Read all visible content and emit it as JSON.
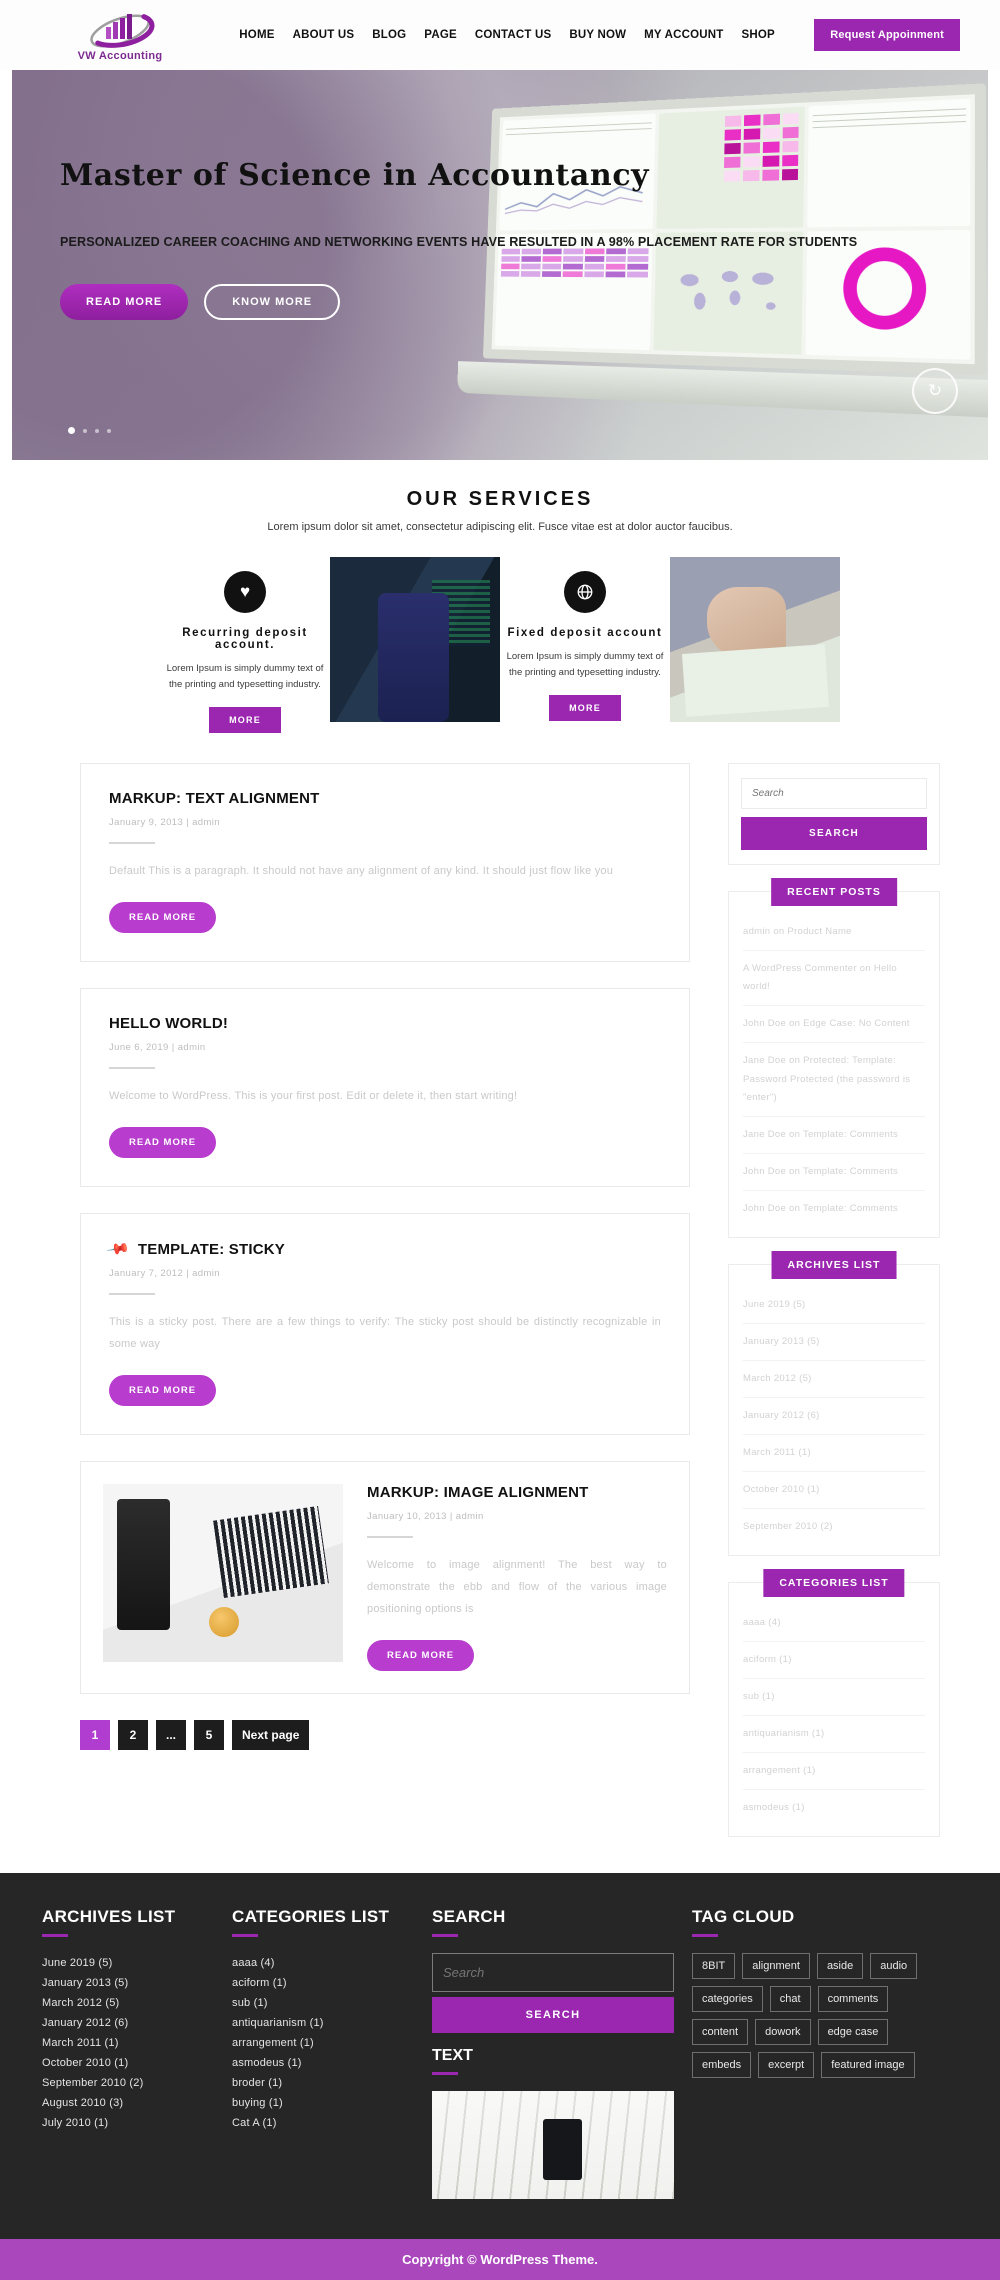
{
  "header": {
    "logo_text": "VW Accounting",
    "nav": [
      {
        "label": "HOME"
      },
      {
        "label": "ABOUT US"
      },
      {
        "label": "BLOG"
      },
      {
        "label": "PAGE"
      },
      {
        "label": "CONTACT US"
      },
      {
        "label": "BUY NOW"
      },
      {
        "label": "MY ACCOUNT"
      },
      {
        "label": "SHOP"
      }
    ],
    "cta_label": "Request Appoinment",
    "accent_color": "#9b27b0"
  },
  "hero": {
    "title": "Master of Science in Accountancy",
    "subtitle": "PERSONALIZED CAREER COACHING AND NETWORKING EVENTS HAVE RESULTED IN A 98% PLACEMENT RATE FOR STUDENTS",
    "btn_primary": "READ MORE",
    "btn_secondary": "KNOW MORE",
    "fab_icon": "refresh-icon"
  },
  "services": {
    "heading": "OUR SERVICES",
    "subheading": "Lorem ipsum dolor sit amet, consectetur adipiscing elit. Fusce vitae est at dolor auctor faucibus.",
    "items": [
      {
        "icon": "heart-icon",
        "glyph": "♥",
        "title": "Recurring deposit account.",
        "text": "Lorem Ipsum is simply dummy text of the printing and typesetting industry.",
        "button": "MORE"
      },
      {
        "icon": "globe-icon",
        "glyph": "🌐",
        "title": "Fixed deposit account",
        "text": "Lorem Ipsum is simply dummy text of the printing and typesetting industry.",
        "button": "MORE"
      }
    ]
  },
  "posts": [
    {
      "title": "MARKUP: TEXT ALIGNMENT",
      "date": "January 9, 2013",
      "author": "admin",
      "excerpt": "Default This is a paragraph. It should not have any alignment of any kind. It should just flow like you",
      "button": "READ MORE",
      "sticky": false,
      "has_image": false
    },
    {
      "title": "HELLO WORLD!",
      "date": "June 6, 2019",
      "author": "admin",
      "excerpt": "Welcome to WordPress. This is your first post. Edit or delete it, then start writing!",
      "button": "READ MORE",
      "sticky": false,
      "has_image": false
    },
    {
      "title": "TEMPLATE: STICKY",
      "date": "January 7, 2012",
      "author": "admin",
      "excerpt": "This is a sticky post. There are a few things to verify: The sticky post should be distinctly recognizable in some way",
      "button": "READ MORE",
      "sticky": true,
      "has_image": false
    },
    {
      "title": "MARKUP: IMAGE ALIGNMENT",
      "date": "January 10, 2013",
      "author": "admin",
      "excerpt": "Welcome to image alignment! The best way to demonstrate the ebb and flow of the various image positioning options is",
      "button": "READ MORE",
      "sticky": false,
      "has_image": true
    }
  ],
  "meta_separator": "|",
  "pagination": {
    "pages": [
      "1",
      "2",
      "...",
      "5"
    ],
    "current": "1",
    "next_label": "Next page"
  },
  "sidebar": {
    "search": {
      "placeholder": "Search",
      "value": "",
      "button": "SEARCH"
    },
    "recent_posts": {
      "title": "RECENT POSTS",
      "items": [
        "admin on Product Name",
        "A WordPress Commenter on Hello world!",
        "John Doe on Edge Case: No Content",
        "Jane Doe on Protected: Template: Password Protected (the password is \"enter\")",
        "Jane Doe on Template: Comments",
        "John Doe on Template: Comments",
        "John Doe on Template: Comments"
      ]
    },
    "archives": {
      "title": "ARCHIVES LIST",
      "items": [
        "June 2019 (5)",
        "January 2013 (5)",
        "March 2012 (5)",
        "January 2012 (6)",
        "March 2011 (1)",
        "October 2010 (1)",
        "September 2010 (2)"
      ]
    },
    "categories": {
      "title": "CATEGORIES LIST",
      "items": [
        "aaaa (4)",
        "aciform (1)",
        "sub (1)",
        "antiquarianism (1)",
        "arrangement (1)",
        "asmodeus (1)"
      ]
    }
  },
  "footer": {
    "archives": {
      "title": "ARCHIVES LIST",
      "items": [
        "June 2019 (5)",
        "January 2013 (5)",
        "March 2012 (5)",
        "January 2012 (6)",
        "March 2011 (1)",
        "October 2010 (1)",
        "September 2010 (2)",
        "August 2010 (3)",
        "July 2010 (1)"
      ]
    },
    "categories": {
      "title": "CATEGORIES LIST",
      "items": [
        "aaaa (4)",
        "aciform (1)",
        "sub (1)",
        "antiquarianism (1)",
        "arrangement (1)",
        "asmodeus (1)",
        "broder (1)",
        "buying (1)",
        "Cat A (1)"
      ]
    },
    "search": {
      "title": "SEARCH",
      "placeholder": "Search",
      "value": "",
      "button": "SEARCH",
      "text_title": "TEXT"
    },
    "tags": {
      "title": "TAG CLOUD",
      "items": [
        "8BIT",
        "alignment",
        "aside",
        "audio",
        "categories",
        "chat",
        "comments",
        "content",
        "dowork",
        "edge case",
        "embeds",
        "excerpt",
        "featured image"
      ]
    }
  },
  "copyright": {
    "prefix": "Copyright ",
    "symbol": "©",
    "text": " WordPress Theme."
  }
}
